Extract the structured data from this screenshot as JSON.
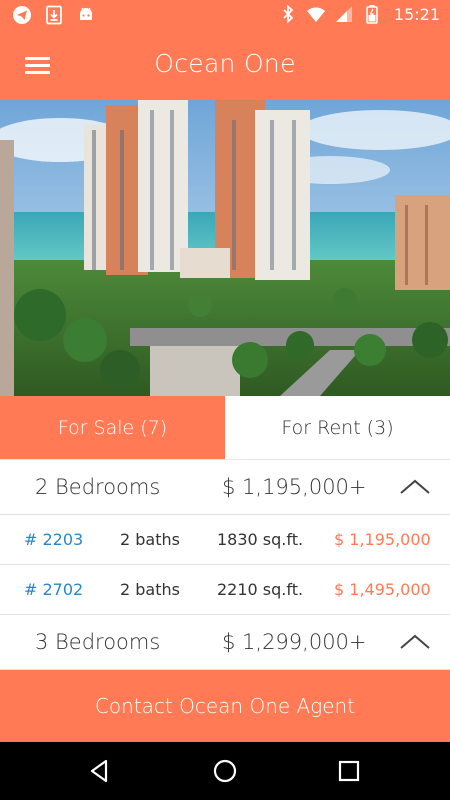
{
  "status_bar": {
    "time": "15:21",
    "left_icons": [
      "telegram-icon",
      "download-icon",
      "android-icon"
    ],
    "right_icons": [
      "bluetooth-icon",
      "wifi-icon",
      "signal-icon",
      "battery-icon"
    ]
  },
  "app_bar": {
    "title": "Ocean One",
    "menu_icon": "hamburger-menu-icon"
  },
  "tabs": [
    {
      "label": "For Sale (7)",
      "active": true
    },
    {
      "label": "For Rent (3)",
      "active": false
    }
  ],
  "groups": [
    {
      "beds": "2 Bedrooms",
      "price": "$ 1,195,000+",
      "expanded": true,
      "units": [
        {
          "number": "# 2203",
          "baths": "2 baths",
          "sqft": "1830 sq.ft.",
          "price": "$ 1,195,000"
        },
        {
          "number": "# 2702",
          "baths": "2 baths",
          "sqft": "2210 sq.ft.",
          "price": "$ 1,495,000"
        }
      ]
    },
    {
      "beds": "3 Bedrooms",
      "price": "$ 1,299,000+",
      "expanded": true,
      "units": []
    }
  ],
  "contact": {
    "label": "Contact Ocean One Agent"
  },
  "colors": {
    "accent": "#FF7A55",
    "link": "#2a87c7"
  },
  "nav_bar": {
    "icons": [
      "back-icon",
      "home-icon",
      "recents-icon"
    ]
  }
}
